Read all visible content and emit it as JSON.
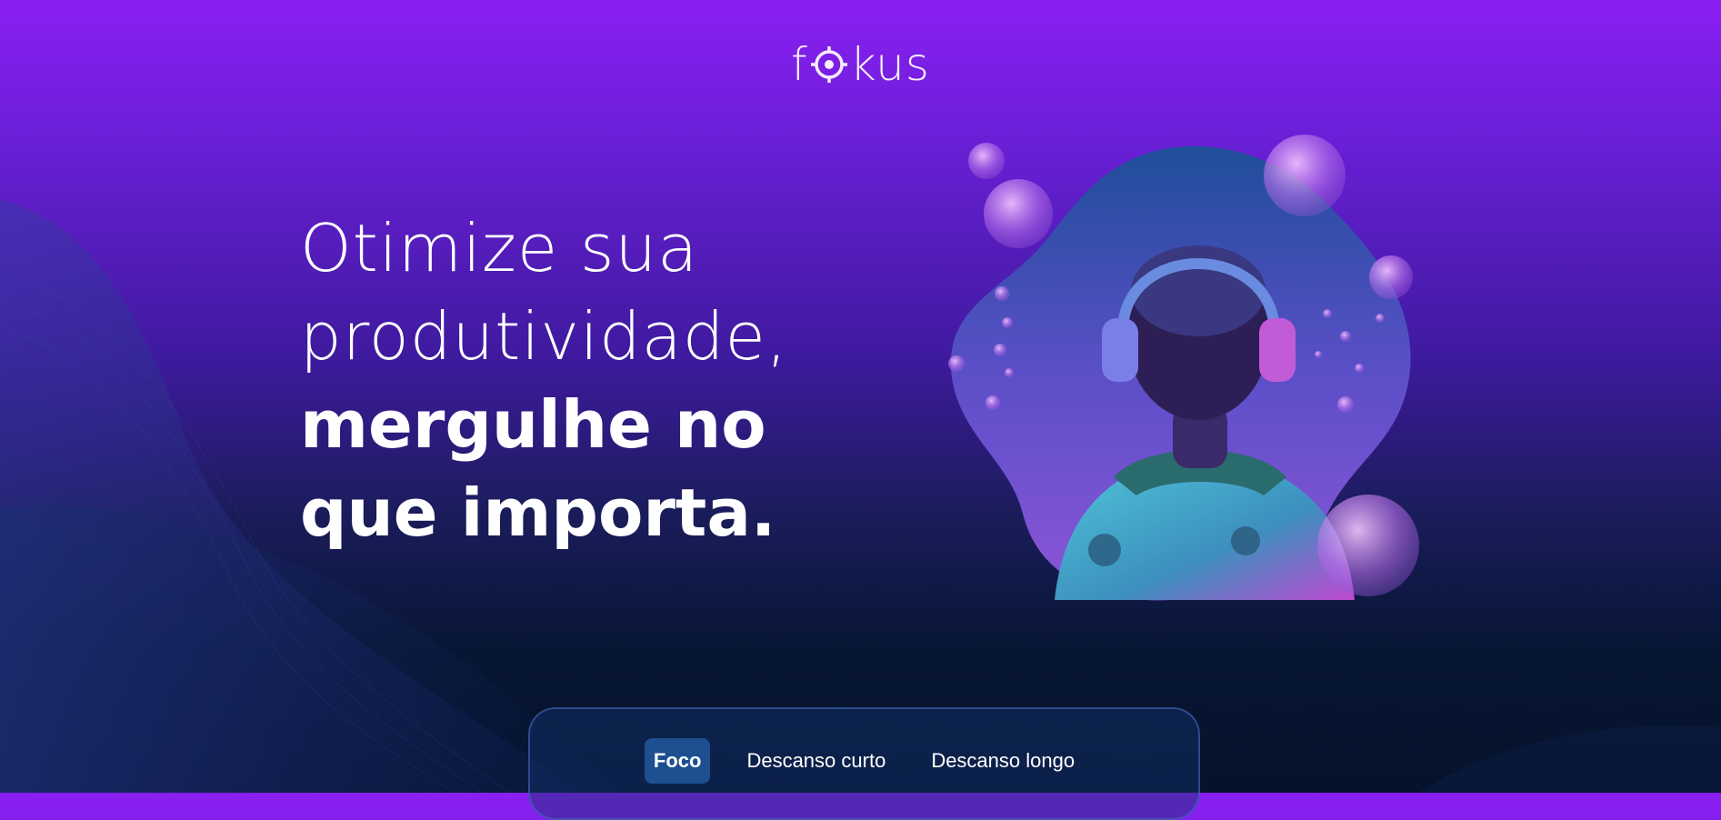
{
  "logo": {
    "text_before": "f",
    "text_after": "kus",
    "icon": "target-icon"
  },
  "headline": {
    "line1": "Otimize sua",
    "line2": "produtividade,",
    "line3": "mergulhe no",
    "line4": "que importa."
  },
  "hero_image": {
    "icon": "person-with-headphones-illustration"
  },
  "timer_card": {
    "tabs": [
      {
        "label": "Foco",
        "active": true
      },
      {
        "label": "Descanso curto",
        "active": false
      },
      {
        "label": "Descanso longo",
        "active": false
      }
    ]
  },
  "colors": {
    "bg_top": "#8a1ff2",
    "bg_bottom": "#05122b",
    "active_tab": "#1d4f91",
    "card_border": "#466ebe"
  }
}
